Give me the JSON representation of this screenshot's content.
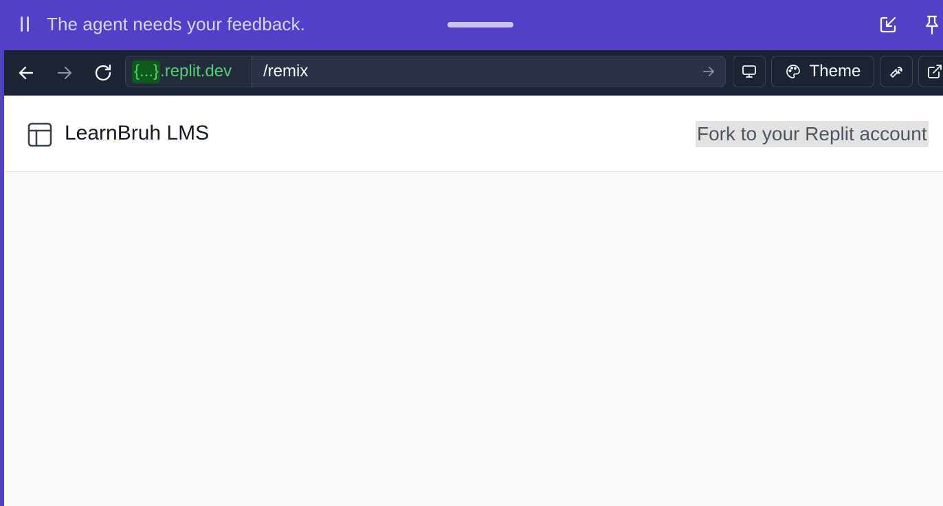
{
  "agent_bar": {
    "message": "The agent needs your feedback."
  },
  "browser": {
    "url_braces": "{...}",
    "url_host": ".replit.dev",
    "url_path": "/remix",
    "theme_label": "Theme"
  },
  "app": {
    "title": "LearnBruh LMS",
    "fork_link": "Fork to your Replit account"
  },
  "colors": {
    "frame": "#5140c8",
    "browser_bar": "#1c2333",
    "url_green": "#52d171",
    "page_bg": "#f8f9fb"
  },
  "icons": [
    "pause-icon",
    "popout-icon",
    "pin-icon",
    "back-arrow-icon",
    "forward-arrow-icon",
    "reload-icon",
    "go-arrow-icon",
    "monitor-icon",
    "palette-icon",
    "wrench-icon",
    "external-link-icon",
    "layout-icon"
  ]
}
